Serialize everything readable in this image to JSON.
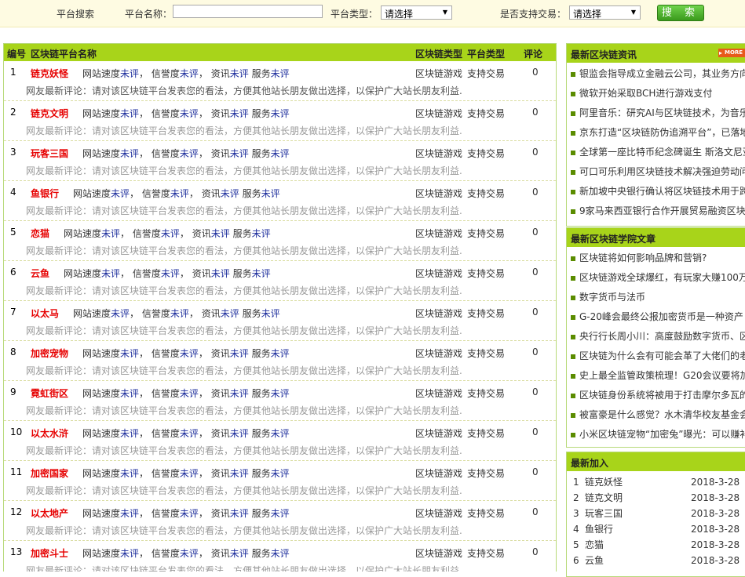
{
  "search": {
    "title": "平台搜索",
    "name_label": "平台名称：",
    "name_value": "",
    "type_label": "平台类型：",
    "type_value": "请选择",
    "trade_label": "是否支持交易：",
    "trade_value": "请选择",
    "button": "搜 索"
  },
  "list": {
    "headers": {
      "no": "编号",
      "name": "区块链平台名称",
      "type": "区块链类型",
      "ptype": "平台类型",
      "comments": "评论"
    },
    "rating_labels": [
      "网站速度",
      "信誉度",
      "资讯",
      "服务"
    ],
    "rating_value": "未评",
    "review_prefix": "网友最新评论：",
    "review_text": "请对该区块链平台发表您的看法，方便其他站长朋友做出选择，以保护广大站长朋友利益.",
    "items": [
      {
        "no": "1",
        "name": "链克妖怪",
        "type": "区块链游戏",
        "ptype": "支持交易",
        "comments": "0"
      },
      {
        "no": "2",
        "name": "链克文明",
        "type": "区块链游戏",
        "ptype": "支持交易",
        "comments": "0"
      },
      {
        "no": "3",
        "name": "玩客三国",
        "type": "区块链游戏",
        "ptype": "支持交易",
        "comments": "0"
      },
      {
        "no": "4",
        "name": "鱼银行",
        "type": "区块链游戏",
        "ptype": "支持交易",
        "comments": "0"
      },
      {
        "no": "5",
        "name": "恋猫",
        "type": "区块链游戏",
        "ptype": "支持交易",
        "comments": "0"
      },
      {
        "no": "6",
        "name": "云鱼",
        "type": "区块链游戏",
        "ptype": "支持交易",
        "comments": "0"
      },
      {
        "no": "7",
        "name": "以太马",
        "type": "区块链游戏",
        "ptype": "支持交易",
        "comments": "0"
      },
      {
        "no": "8",
        "name": "加密宠物",
        "type": "区块链游戏",
        "ptype": "支持交易",
        "comments": "0"
      },
      {
        "no": "9",
        "name": "霓虹街区",
        "type": "区块链游戏",
        "ptype": "支持交易",
        "comments": "0"
      },
      {
        "no": "10",
        "name": "以太水浒",
        "type": "区块链游戏",
        "ptype": "支持交易",
        "comments": "0"
      },
      {
        "no": "11",
        "name": "加密国家",
        "type": "区块链游戏",
        "ptype": "支持交易",
        "comments": "0"
      },
      {
        "no": "12",
        "name": "以太地产",
        "type": "区块链游戏",
        "ptype": "支持交易",
        "comments": "0"
      },
      {
        "no": "13",
        "name": "加密斗士",
        "type": "区块链游戏",
        "ptype": "支持交易",
        "comments": "0"
      }
    ]
  },
  "news": {
    "title": "最新区块链资讯",
    "more": "MORE",
    "items": [
      "银监会指导成立金融云公司，其业务方向",
      "微软开始采取BCH进行游戏支付",
      "阿里音乐：研究AI与区块链技术，为音乐",
      "京东打造“区块链防伪追溯平台”，已落地",
      "全球第一座比特币纪念碑诞生 斯洛文尼亚",
      "可口可乐利用区块链技术解决强迫劳动问",
      "新加坡中央银行确认将区块链技术用于跨",
      "9家马来西亚银行合作开展贸易融资区块"
    ]
  },
  "academy": {
    "title": "最新区块链学院文章",
    "items": [
      "区块链将如何影响品牌和营销?",
      "区块链游戏全球爆红，有玩家大赚100万",
      "数字货币与法币",
      "G-20峰会最终公报加密货币是一种资产",
      "央行行长周小川：高度鼓励数字货币、区",
      "区块链为什么会有可能会革了大佬们的老",
      "史上最全监管政策梳理！G20会议要将加",
      "区块链身份系统将被用于打击摩尔多瓦的",
      "被富豪是什么感觉？水木清华校友基金会",
      "小米区块链宠物“加密兔”曝光：可以赚补"
    ]
  },
  "latest": {
    "title": "最新加入",
    "items": [
      {
        "no": "1",
        "name": "链克妖怪",
        "date": "2018-3-28"
      },
      {
        "no": "2",
        "name": "链克文明",
        "date": "2018-3-28"
      },
      {
        "no": "3",
        "name": "玩客三国",
        "date": "2018-3-28"
      },
      {
        "no": "4",
        "name": "鱼银行",
        "date": "2018-3-28"
      },
      {
        "no": "5",
        "name": "恋猫",
        "date": "2018-3-28"
      },
      {
        "no": "6",
        "name": "云鱼",
        "date": "2018-3-28"
      }
    ]
  }
}
